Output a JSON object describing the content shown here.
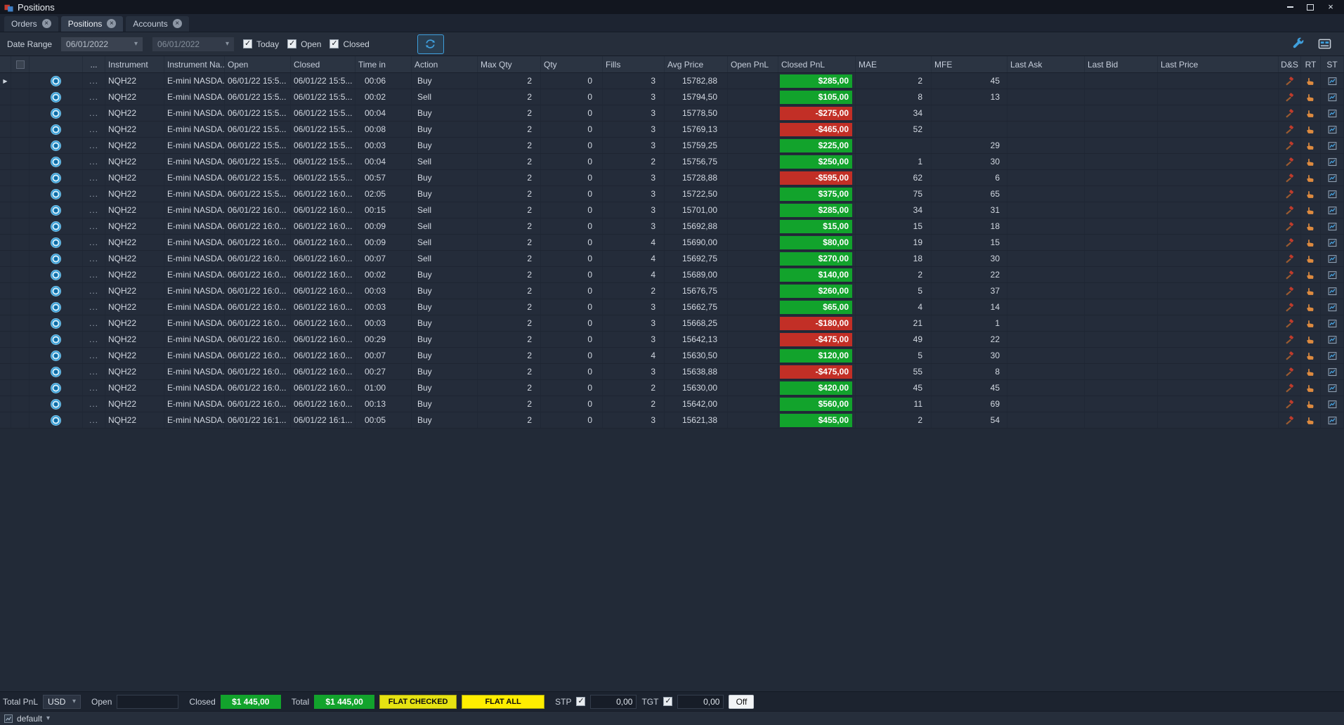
{
  "window": {
    "title": "Positions"
  },
  "glyphs": {
    "close": "×",
    "caret_down": "▾",
    "check": "✓",
    "ellipsis": "...",
    "row_marker": "▶"
  },
  "colors": {
    "pnl_green": "#12a32c",
    "pnl_red": "#c22f26",
    "accent_blue": "#3f9fdc",
    "flat_checked_yellow": "#e6e312",
    "flat_all_yellow": "#ffee00"
  },
  "tabs": [
    {
      "label": "Orders"
    },
    {
      "label": "Positions",
      "active": true
    },
    {
      "label": "Accounts"
    }
  ],
  "toolbar": {
    "date_range_label": "Date Range",
    "date_from": "06/01/2022",
    "date_to": "06/01/2022",
    "checkboxes": [
      {
        "label": "Today",
        "checked": true
      },
      {
        "label": "Open",
        "checked": true
      },
      {
        "label": "Closed",
        "checked": true
      }
    ]
  },
  "table": {
    "columns": [
      "",
      "",
      "",
      "...",
      "Instrument",
      "Instrument Na...",
      "Open",
      "Closed",
      "Time in",
      "Action",
      "Max Qty",
      "Qty",
      "Fills",
      "Avg Price",
      "Open PnL",
      "Closed PnL",
      "MAE",
      "MFE",
      "Last Ask",
      "Last Bid",
      "Last Price",
      "D&S",
      "RT",
      "ST"
    ],
    "rows": [
      {
        "instrument": "NQH22",
        "instrument_name": "E-mini NASDA...",
        "open": "06/01/22 15:5...",
        "closed": "06/01/22 15:5...",
        "time_in": "00:06",
        "action": "Buy",
        "max_qty": "2",
        "qty": "0",
        "fills": "3",
        "avg_price": "15782,88",
        "closed_pnl": "$285,00",
        "mae": "2",
        "mfe": "45"
      },
      {
        "instrument": "NQH22",
        "instrument_name": "E-mini NASDA...",
        "open": "06/01/22 15:5...",
        "closed": "06/01/22 15:5...",
        "time_in": "00:02",
        "action": "Sell",
        "max_qty": "2",
        "qty": "0",
        "fills": "3",
        "avg_price": "15794,50",
        "closed_pnl": "$105,00",
        "mae": "8",
        "mfe": "13"
      },
      {
        "instrument": "NQH22",
        "instrument_name": "E-mini NASDA...",
        "open": "06/01/22 15:5...",
        "closed": "06/01/22 15:5...",
        "time_in": "00:04",
        "action": "Buy",
        "max_qty": "2",
        "qty": "0",
        "fills": "3",
        "avg_price": "15778,50",
        "closed_pnl": "-$275,00",
        "mae": "34",
        "mfe": ""
      },
      {
        "instrument": "NQH22",
        "instrument_name": "E-mini NASDA...",
        "open": "06/01/22 15:5...",
        "closed": "06/01/22 15:5...",
        "time_in": "00:08",
        "action": "Buy",
        "max_qty": "2",
        "qty": "0",
        "fills": "3",
        "avg_price": "15769,13",
        "closed_pnl": "-$465,00",
        "mae": "52",
        "mfe": ""
      },
      {
        "instrument": "NQH22",
        "instrument_name": "E-mini NASDA...",
        "open": "06/01/22 15:5...",
        "closed": "06/01/22 15:5...",
        "time_in": "00:03",
        "action": "Buy",
        "max_qty": "2",
        "qty": "0",
        "fills": "3",
        "avg_price": "15759,25",
        "closed_pnl": "$225,00",
        "mae": "",
        "mfe": "29"
      },
      {
        "instrument": "NQH22",
        "instrument_name": "E-mini NASDA...",
        "open": "06/01/22 15:5...",
        "closed": "06/01/22 15:5...",
        "time_in": "00:04",
        "action": "Sell",
        "max_qty": "2",
        "qty": "0",
        "fills": "2",
        "avg_price": "15756,75",
        "closed_pnl": "$250,00",
        "mae": "1",
        "mfe": "30"
      },
      {
        "instrument": "NQH22",
        "instrument_name": "E-mini NASDA...",
        "open": "06/01/22 15:5...",
        "closed": "06/01/22 15:5...",
        "time_in": "00:57",
        "action": "Buy",
        "max_qty": "2",
        "qty": "0",
        "fills": "3",
        "avg_price": "15728,88",
        "closed_pnl": "-$595,00",
        "mae": "62",
        "mfe": "6"
      },
      {
        "instrument": "NQH22",
        "instrument_name": "E-mini NASDA...",
        "open": "06/01/22 15:5...",
        "closed": "06/01/22 16:0...",
        "time_in": "02:05",
        "action": "Buy",
        "max_qty": "2",
        "qty": "0",
        "fills": "3",
        "avg_price": "15722,50",
        "closed_pnl": "$375,00",
        "mae": "75",
        "mfe": "65"
      },
      {
        "instrument": "NQH22",
        "instrument_name": "E-mini NASDA...",
        "open": "06/01/22 16:0...",
        "closed": "06/01/22 16:0...",
        "time_in": "00:15",
        "action": "Sell",
        "max_qty": "2",
        "qty": "0",
        "fills": "3",
        "avg_price": "15701,00",
        "closed_pnl": "$285,00",
        "mae": "34",
        "mfe": "31"
      },
      {
        "instrument": "NQH22",
        "instrument_name": "E-mini NASDA...",
        "open": "06/01/22 16:0...",
        "closed": "06/01/22 16:0...",
        "time_in": "00:09",
        "action": "Sell",
        "max_qty": "2",
        "qty": "0",
        "fills": "3",
        "avg_price": "15692,88",
        "closed_pnl": "$15,00",
        "mae": "15",
        "mfe": "18"
      },
      {
        "instrument": "NQH22",
        "instrument_name": "E-mini NASDA...",
        "open": "06/01/22 16:0...",
        "closed": "06/01/22 16:0...",
        "time_in": "00:09",
        "action": "Sell",
        "max_qty": "2",
        "qty": "0",
        "fills": "4",
        "avg_price": "15690,00",
        "closed_pnl": "$80,00",
        "mae": "19",
        "mfe": "15"
      },
      {
        "instrument": "NQH22",
        "instrument_name": "E-mini NASDA...",
        "open": "06/01/22 16:0...",
        "closed": "06/01/22 16:0...",
        "time_in": "00:07",
        "action": "Sell",
        "max_qty": "2",
        "qty": "0",
        "fills": "4",
        "avg_price": "15692,75",
        "closed_pnl": "$270,00",
        "mae": "18",
        "mfe": "30"
      },
      {
        "instrument": "NQH22",
        "instrument_name": "E-mini NASDA...",
        "open": "06/01/22 16:0...",
        "closed": "06/01/22 16:0...",
        "time_in": "00:02",
        "action": "Buy",
        "max_qty": "2",
        "qty": "0",
        "fills": "4",
        "avg_price": "15689,00",
        "closed_pnl": "$140,00",
        "mae": "2",
        "mfe": "22"
      },
      {
        "instrument": "NQH22",
        "instrument_name": "E-mini NASDA...",
        "open": "06/01/22 16:0...",
        "closed": "06/01/22 16:0...",
        "time_in": "00:03",
        "action": "Buy",
        "max_qty": "2",
        "qty": "0",
        "fills": "2",
        "avg_price": "15676,75",
        "closed_pnl": "$260,00",
        "mae": "5",
        "mfe": "37"
      },
      {
        "instrument": "NQH22",
        "instrument_name": "E-mini NASDA...",
        "open": "06/01/22 16:0...",
        "closed": "06/01/22 16:0...",
        "time_in": "00:03",
        "action": "Buy",
        "max_qty": "2",
        "qty": "0",
        "fills": "3",
        "avg_price": "15662,75",
        "closed_pnl": "$65,00",
        "mae": "4",
        "mfe": "14"
      },
      {
        "instrument": "NQH22",
        "instrument_name": "E-mini NASDA...",
        "open": "06/01/22 16:0...",
        "closed": "06/01/22 16:0...",
        "time_in": "00:03",
        "action": "Buy",
        "max_qty": "2",
        "qty": "0",
        "fills": "3",
        "avg_price": "15668,25",
        "closed_pnl": "-$180,00",
        "mae": "21",
        "mfe": "1"
      },
      {
        "instrument": "NQH22",
        "instrument_name": "E-mini NASDA...",
        "open": "06/01/22 16:0...",
        "closed": "06/01/22 16:0...",
        "time_in": "00:29",
        "action": "Buy",
        "max_qty": "2",
        "qty": "0",
        "fills": "3",
        "avg_price": "15642,13",
        "closed_pnl": "-$475,00",
        "mae": "49",
        "mfe": "22"
      },
      {
        "instrument": "NQH22",
        "instrument_name": "E-mini NASDA...",
        "open": "06/01/22 16:0...",
        "closed": "06/01/22 16:0...",
        "time_in": "00:07",
        "action": "Buy",
        "max_qty": "2",
        "qty": "0",
        "fills": "4",
        "avg_price": "15630,50",
        "closed_pnl": "$120,00",
        "mae": "5",
        "mfe": "30"
      },
      {
        "instrument": "NQH22",
        "instrument_name": "E-mini NASDA...",
        "open": "06/01/22 16:0...",
        "closed": "06/01/22 16:0...",
        "time_in": "00:27",
        "action": "Buy",
        "max_qty": "2",
        "qty": "0",
        "fills": "3",
        "avg_price": "15638,88",
        "closed_pnl": "-$475,00",
        "mae": "55",
        "mfe": "8"
      },
      {
        "instrument": "NQH22",
        "instrument_name": "E-mini NASDA...",
        "open": "06/01/22 16:0...",
        "closed": "06/01/22 16:0...",
        "time_in": "01:00",
        "action": "Buy",
        "max_qty": "2",
        "qty": "0",
        "fills": "2",
        "avg_price": "15630,00",
        "closed_pnl": "$420,00",
        "mae": "45",
        "mfe": "45"
      },
      {
        "instrument": "NQH22",
        "instrument_name": "E-mini NASDA...",
        "open": "06/01/22 16:0...",
        "closed": "06/01/22 16:0...",
        "time_in": "00:13",
        "action": "Buy",
        "max_qty": "2",
        "qty": "0",
        "fills": "2",
        "avg_price": "15642,00",
        "closed_pnl": "$560,00",
        "mae": "11",
        "mfe": "69"
      },
      {
        "instrument": "NQH22",
        "instrument_name": "E-mini NASDA...",
        "open": "06/01/22 16:1...",
        "closed": "06/01/22 16:1...",
        "time_in": "00:05",
        "action": "Buy",
        "max_qty": "2",
        "qty": "0",
        "fills": "3",
        "avg_price": "15621,38",
        "closed_pnl": "$455,00",
        "mae": "2",
        "mfe": "54"
      }
    ]
  },
  "footer": {
    "total_pnl_label": "Total PnL",
    "currency": "USD",
    "open_label": "Open",
    "open_value": "",
    "closed_label": "Closed",
    "closed_value": "$1 445,00",
    "total_label": "Total",
    "total_value": "$1 445,00",
    "flat_checked_label": "FLAT CHECKED",
    "flat_all_label": "FLAT ALL",
    "stp_label": "STP",
    "stp_checked": true,
    "stp_value": "0,00",
    "tgt_label": "TGT",
    "tgt_checked": true,
    "tgt_value": "0,00",
    "off_label": "Off"
  },
  "statusbar": {
    "profile": "default"
  }
}
